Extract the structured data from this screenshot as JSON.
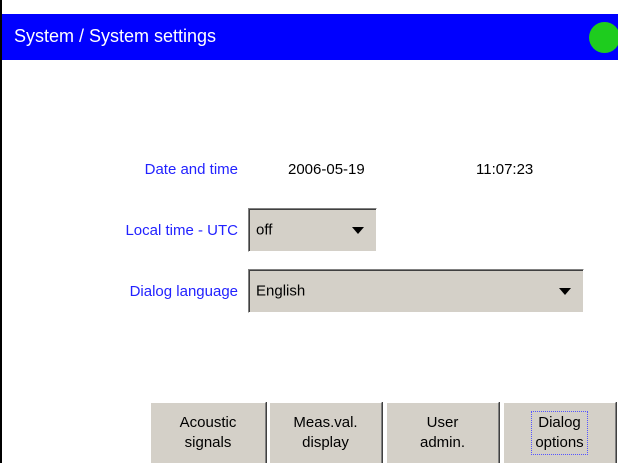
{
  "header": {
    "title": "System / System settings",
    "status_color": "#1ecc1e"
  },
  "settings": {
    "date_time_label": "Date and time",
    "date": "2006-05-19",
    "time": "11:07:23",
    "utc_label": "Local time - UTC",
    "utc_value": "off",
    "language_label": "Dialog language",
    "language_value": "English"
  },
  "buttons": [
    {
      "line1": "Acoustic",
      "line2": "signals"
    },
    {
      "line1": "Meas.val.",
      "line2": "display"
    },
    {
      "line1": "User",
      "line2": "admin."
    },
    {
      "line1": "Dialog",
      "line2": "options"
    }
  ],
  "colors": {
    "header_bg": "#0000ff",
    "label_text": "#2222ff",
    "panel_gray": "#d4d0c8"
  }
}
